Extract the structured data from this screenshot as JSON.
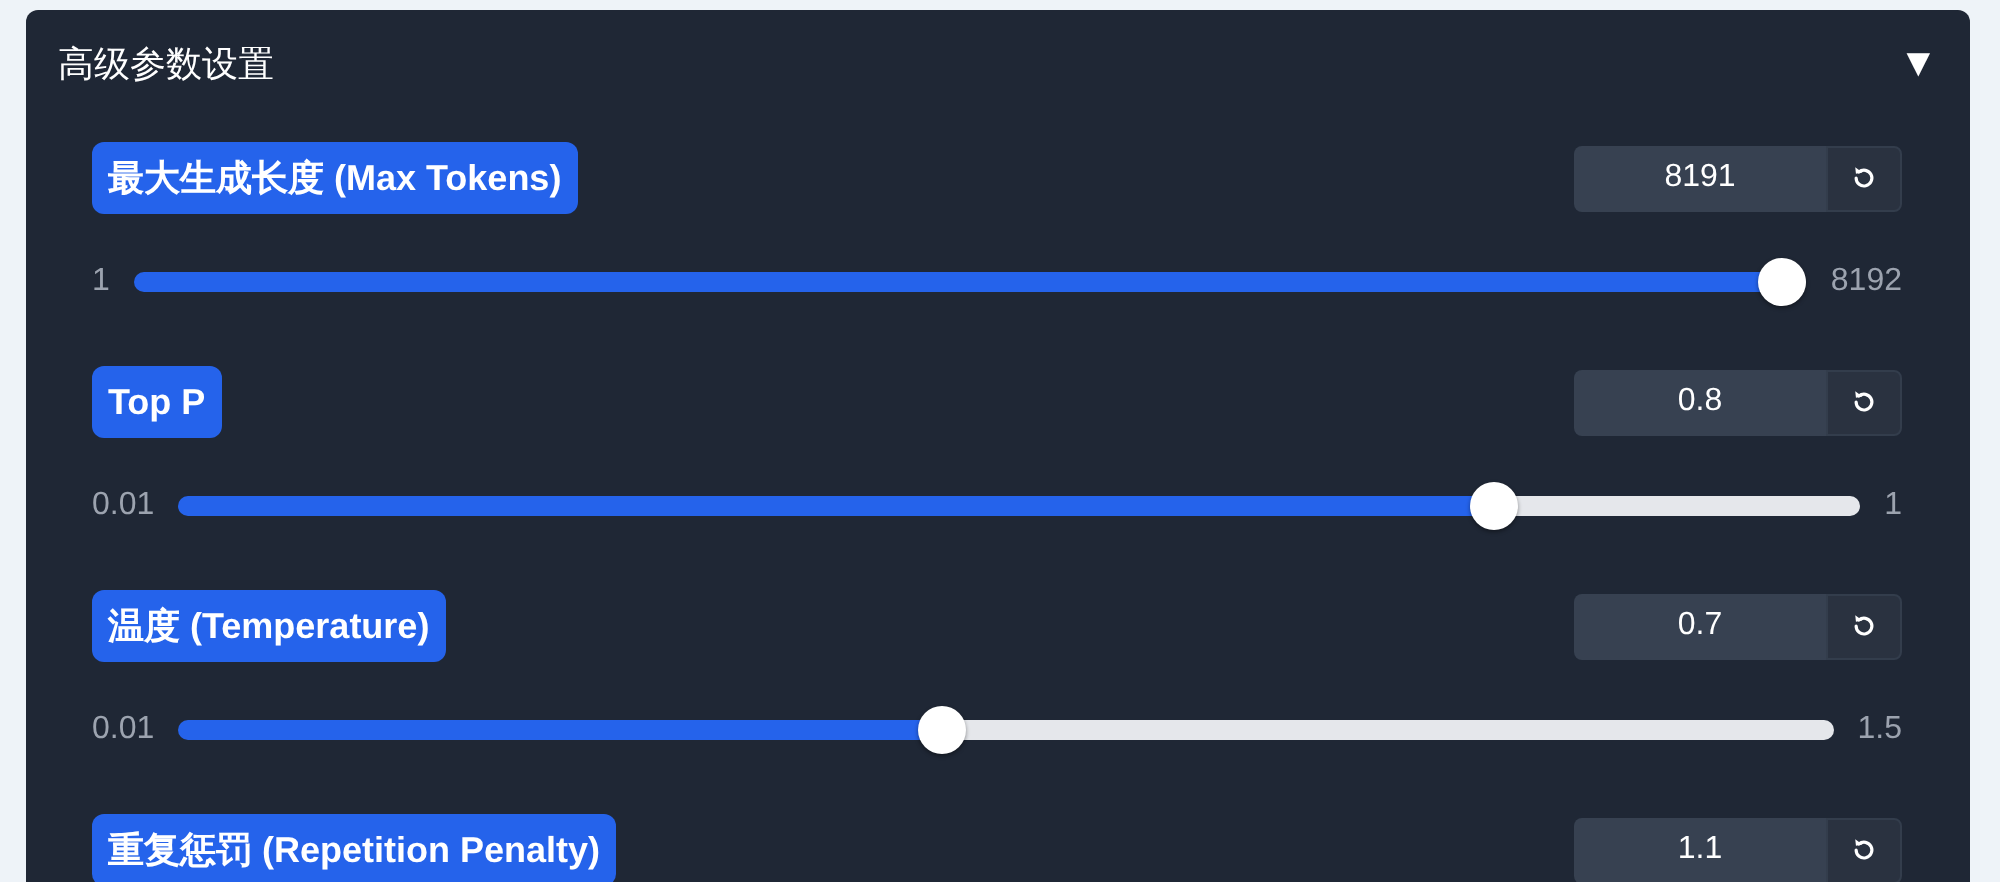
{
  "panel": {
    "title": "高级参数设置",
    "toggle": "▼",
    "expanded": true
  },
  "params": [
    {
      "label": "最大生成长度 (Max Tokens)",
      "value": "8191",
      "min": "1",
      "max": "8192",
      "level": 1.0
    },
    {
      "label": "Top P",
      "value": "0.8",
      "min": "0.01",
      "max": "1",
      "level": 0.79
    },
    {
      "label": "温度 (Temperature)",
      "value": "0.7",
      "min": "0.01",
      "max": "1.5",
      "level": 0.46
    },
    {
      "label": "重复惩罚 (Repetition Penalty)",
      "value": "1.1"
    }
  ]
}
